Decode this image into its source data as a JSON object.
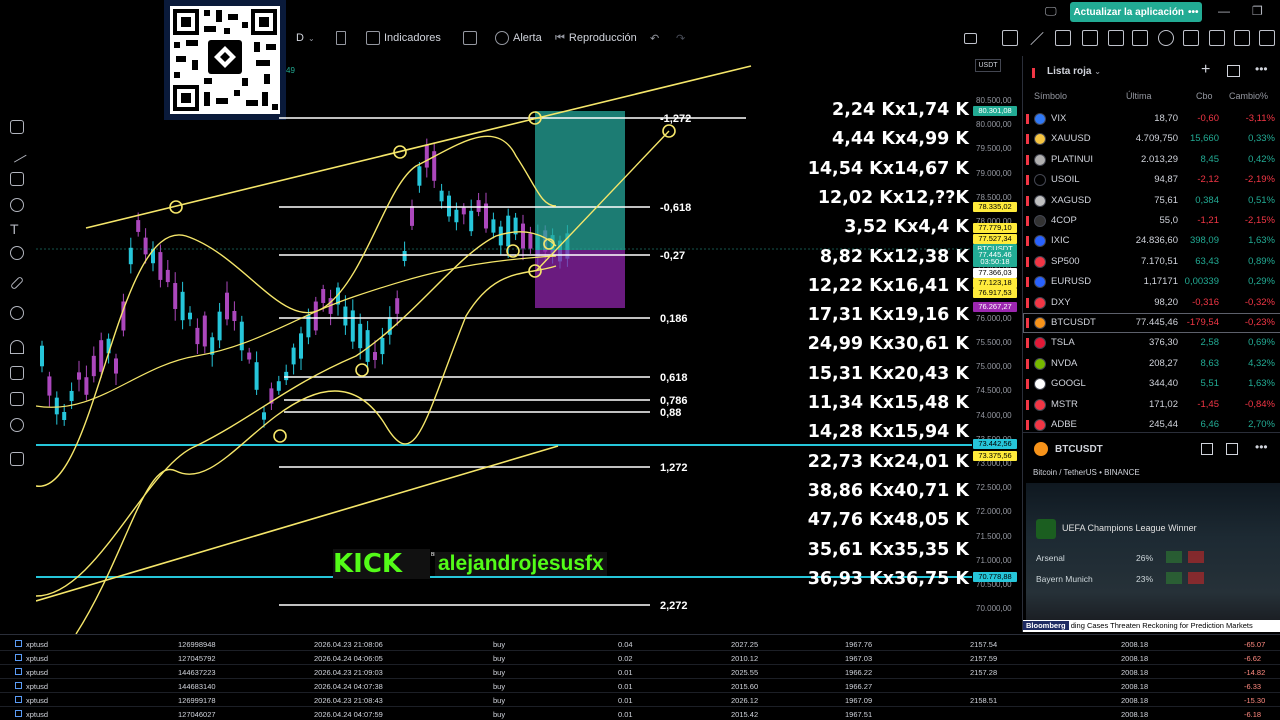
{
  "toolbar": {
    "interval": "D",
    "indicators": "Indicadores",
    "alert": "Alerta",
    "replay": "Reproducción",
    "update_app": "Actualizar la aplicación",
    "currency": "USDT",
    "partial_value": "49"
  },
  "fib_levels": [
    "-1,272",
    "-0,618",
    "-0,27",
    "0,186",
    "0,618",
    "0,786",
    "0,88",
    "1,272",
    "2,272"
  ],
  "size_list": [
    "2,24 Kx1,74 K",
    "4,44 Kx4,99 K",
    "14,54 Kx14,67 K",
    "12,02 Kx12,??K",
    "3,52 Kx4,4 K",
    "8,82 Kx12,38 K",
    "12,22 Kx16,41 K",
    "17,31 Kx19,16 K",
    "24,99 Kx30,61 K",
    "15,31 Kx20,43 K",
    "11,34 Kx15,48 K",
    "14,28 Kx15,94 K",
    "22,73 Kx24,01 K",
    "38,86 Kx40,71 K",
    "47,76 Kx48,05 K",
    "35,61 Kx35,35 K",
    "36,93 Kx36,75 K"
  ],
  "price_scale": [
    "80.500,00",
    "80.000,00",
    "79.500,00",
    "79.000,00",
    "78.500,00",
    "78.000,00",
    "77.500,00",
    "77.000,00",
    "76.500,00",
    "76.000,00",
    "75.500,00",
    "75.000,00",
    "74.500,00",
    "74.000,00",
    "73.500,00",
    "73.000,00",
    "72.500,00",
    "72.000,00",
    "71.500,00",
    "71.000,00",
    "70.500,00",
    "70.000,00"
  ],
  "price_tags": [
    {
      "label": "80.301,08",
      "color": "#22ab94"
    },
    {
      "label": "78.335,02",
      "color": "#ffeb3b"
    },
    {
      "label": "77.779,10",
      "color": "#ffeb3b"
    },
    {
      "label": "77.527,34",
      "color": "#ffeb3b"
    },
    {
      "label": "BTCUSDT",
      "color": "#22ab94"
    },
    {
      "label": "77.445,46",
      "color": "#22ab94"
    },
    {
      "label": "03:50:18",
      "color": "#22ab94"
    },
    {
      "label": "77.366,03",
      "color": "#ffffff"
    },
    {
      "label": "77.123,18",
      "color": "#ffeb3b"
    },
    {
      "label": "76.917,53",
      "color": "#ffeb3b"
    },
    {
      "label": "76.267,27",
      "color": "#9c27b0"
    },
    {
      "label": "73.442,56",
      "color": "#26c6da"
    },
    {
      "label": "73.375,56",
      "color": "#ffeb3b"
    },
    {
      "label": "70.778,88",
      "color": "#26c6da"
    }
  ],
  "kick": {
    "logo": "KICK",
    "beta": "BETA",
    "user": "alejandrojesusfx"
  },
  "watchlist": {
    "title": "Lista roja",
    "col_symbol": "Símbolo",
    "col_last": "Última",
    "col_chg": "Cbo",
    "col_pct": "Cambio%",
    "rows": [
      {
        "sym": "VIX",
        "last": "18,70",
        "chg": "-0,60",
        "pct": "-3,11%",
        "dir": "neg",
        "icon": "#3179f5"
      },
      {
        "sym": "XAUUSD",
        "last": "4.709,750",
        "chg": "15,660",
        "pct": "0,33%",
        "dir": "pos",
        "icon": "#f5c542"
      },
      {
        "sym": "PLATINUI",
        "last": "2.013,29",
        "chg": "8,45",
        "pct": "0,42%",
        "dir": "pos",
        "icon": "#b0b0b0"
      },
      {
        "sym": "USOIL",
        "last": "94,87",
        "chg": "-2,12",
        "pct": "-2,19%",
        "dir": "neg",
        "icon": "#000000"
      },
      {
        "sym": "XAGUSD",
        "last": "75,61",
        "chg": "0,384",
        "pct": "0,51%",
        "dir": "pos",
        "icon": "#c0c0c0"
      },
      {
        "sym": "4COP",
        "last": "55,0",
        "chg": "-1,21",
        "pct": "-2,15%",
        "dir": "neg",
        "icon": "#333333"
      },
      {
        "sym": "IXIC",
        "last": "24.836,60",
        "chg": "398,09",
        "pct": "1,63%",
        "dir": "pos",
        "icon": "#2962ff"
      },
      {
        "sym": "SP500",
        "last": "7.170,51",
        "chg": "63,43",
        "pct": "0,89%",
        "dir": "pos",
        "icon": "#f23645"
      },
      {
        "sym": "EURUSD",
        "last": "1,17171",
        "chg": "0,00339",
        "pct": "0,29%",
        "dir": "pos",
        "icon": "#2962ff"
      },
      {
        "sym": "DXY",
        "last": "98,20",
        "chg": "-0,316",
        "pct": "-0,32%",
        "dir": "neg",
        "icon": "#f23645"
      },
      {
        "sym": "BTCUSDT",
        "last": "77.445,46",
        "chg": "-179,54",
        "pct": "-0,23%",
        "dir": "neg",
        "icon": "#f7931a",
        "selected": true
      },
      {
        "sym": "TSLA",
        "last": "376,30",
        "chg": "2,58",
        "pct": "0,69%",
        "dir": "pos",
        "icon": "#e31937"
      },
      {
        "sym": "NVDA",
        "last": "208,27",
        "chg": "8,63",
        "pct": "4,32%",
        "dir": "pos",
        "icon": "#76b900"
      },
      {
        "sym": "GOOGL",
        "last": "344,40",
        "chg": "5,51",
        "pct": "1,63%",
        "dir": "pos",
        "icon": "#ffffff"
      },
      {
        "sym": "MSTR",
        "last": "171,02",
        "chg": "-1,45",
        "pct": "-0,84%",
        "dir": "neg",
        "icon": "#f23645"
      },
      {
        "sym": "ADBE",
        "last": "245,44",
        "chg": "6,46",
        "pct": "2,70%",
        "dir": "pos",
        "icon": "#f23645"
      }
    ]
  },
  "detail": {
    "symbol": "BTCUSDT",
    "subtitle": "Bitcoin / TetherUS",
    "exchange": "BINANCE",
    "video_title": "UEFA Champions League Winner",
    "video_rows": [
      {
        "team": "Arsenal",
        "pct": "26%"
      },
      {
        "team": "Bayern Munich",
        "pct": "23%"
      }
    ],
    "ticker_brand": "Bloomberg",
    "ticker_text": "ding Cases Threaten Reckoning for Prediction Markets"
  },
  "trades": [
    {
      "sym": "xptusd",
      "id": "126998948",
      "time": "2026.04.23 21:08:06",
      "side": "buy",
      "vol": "0.04",
      "open": "2027.25",
      "sl": "1967.76",
      "tp": "2157.54",
      "cur": "2008.18",
      "pl": "-65.07"
    },
    {
      "sym": "xptusd",
      "id": "127045792",
      "time": "2026.04.24 04:06:05",
      "side": "buy",
      "vol": "0.02",
      "open": "2010.12",
      "sl": "1967.03",
      "tp": "2157.59",
      "cur": "2008.18",
      "pl": "-6.62"
    },
    {
      "sym": "xptusd",
      "id": "144637223",
      "time": "2026.04.23 21:09:03",
      "side": "buy",
      "vol": "0.01",
      "open": "2025.55",
      "sl": "1966.22",
      "tp": "2157.28",
      "cur": "2008.18",
      "pl": "-14.82"
    },
    {
      "sym": "xptusd",
      "id": "144683140",
      "time": "2026.04.24 04:07:38",
      "side": "buy",
      "vol": "0.01",
      "open": "2015.60",
      "sl": "1966.27",
      "tp": "",
      "cur": "2008.18",
      "pl": "-6.33"
    },
    {
      "sym": "xptusd",
      "id": "126999178",
      "time": "2026.04.23 21:08:43",
      "side": "buy",
      "vol": "0.01",
      "open": "2026.12",
      "sl": "1967.09",
      "tp": "2158.51",
      "cur": "2008.18",
      "pl": "-15.30"
    },
    {
      "sym": "xptusd",
      "id": "127046027",
      "time": "2026.04.24 04:07:59",
      "side": "buy",
      "vol": "0.01",
      "open": "2015.42",
      "sl": "1967.51",
      "tp": "",
      "cur": "2008.18",
      "pl": "-6.18"
    }
  ]
}
